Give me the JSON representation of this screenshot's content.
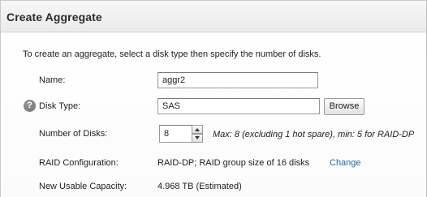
{
  "dialog": {
    "title": "Create Aggregate"
  },
  "intro": "To create an aggregate, select a disk type then specify the number of disks.",
  "form": {
    "name_label": "Name:",
    "name_value": "aggr2",
    "disk_type_label": "Disk Type:",
    "disk_type_value": "SAS",
    "browse_label": "Browse",
    "help_icon_glyph": "?",
    "num_disks_label": "Number of Disks:",
    "num_disks_value": "8",
    "num_disks_hint": "Max: 8 (excluding 1 hot spare), min: 5 for RAID-DP",
    "raid_label": "RAID Configuration:",
    "raid_value": "RAID-DP; RAID group size of 16 disks",
    "change_label": "Change",
    "capacity_label": "New Usable Capacity:",
    "capacity_value": "4.968 TB (Estimated)"
  },
  "colors": {
    "link": "#1a6bb0",
    "titlebar": "#f0f0f0"
  },
  "icons": {
    "help": "help-icon",
    "spin_up": "arrow-up-icon",
    "spin_down": "arrow-down-icon"
  }
}
